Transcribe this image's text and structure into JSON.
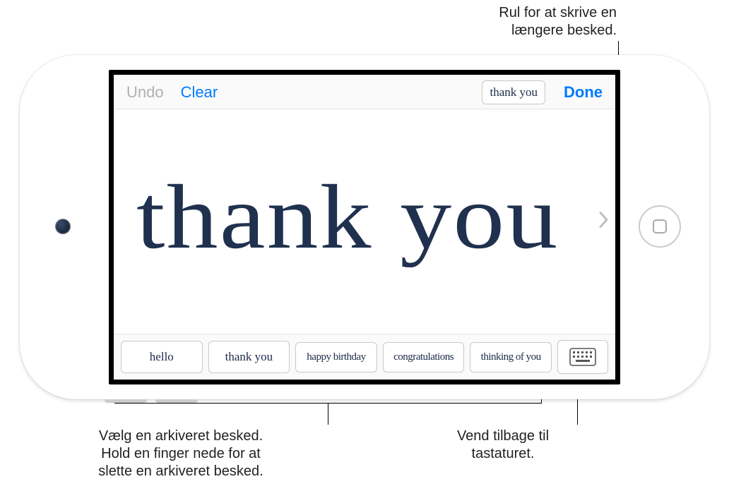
{
  "callouts": {
    "scroll": "Rul for at skrive en\nlængere besked.",
    "select": "Vælg en arkiveret besked.\nHold en finger nede for at\nslette en arkiveret besked.",
    "keyboard": "Vend tilbage til\ntastaturet."
  },
  "topbar": {
    "undo": "Undo",
    "clear": "Clear",
    "preview": "thank you",
    "done": "Done"
  },
  "canvas": {
    "text": "thank you"
  },
  "suggestions": {
    "items": [
      "hello",
      "thank you",
      "happy birthday",
      "congratulations",
      "thinking of you"
    ]
  },
  "icons": {
    "chevron_right": "chevron-right-icon",
    "keyboard": "keyboard-icon"
  }
}
